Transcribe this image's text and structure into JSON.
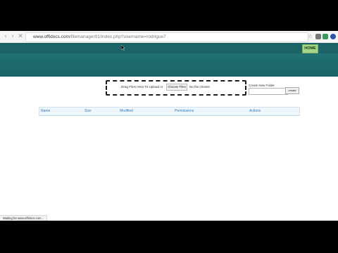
{
  "browser": {
    "url_host": "www.offidocs.com",
    "url_path": "/filemanager01/index.php?username=rodrigue7",
    "status_text": "Waiting for www.offidocs.com..."
  },
  "header": {
    "home_label": "HOME"
  },
  "upload": {
    "drop_text": "Drag Files Here To Upload or",
    "choose_files_label": "Choose Files",
    "no_file_text": "No file chosen"
  },
  "create_folder": {
    "label": "Create New Folder",
    "input_value": "",
    "button_label": "create"
  },
  "file_table": {
    "columns": [
      "Name",
      "Size",
      "Modified",
      "Permissions",
      "Actions"
    ]
  }
}
